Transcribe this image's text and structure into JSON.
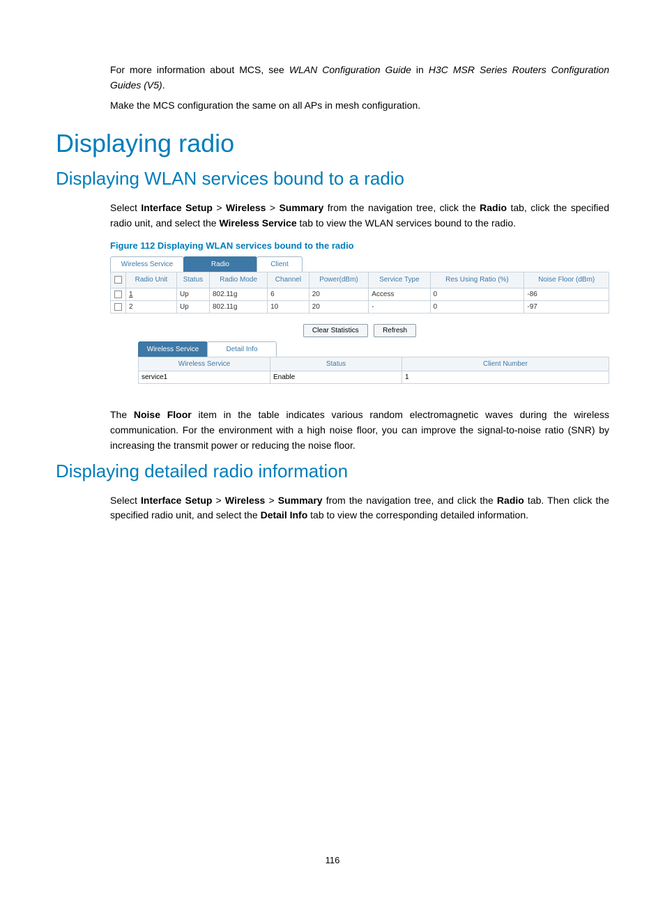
{
  "intro": {
    "p1_a": "For more information about MCS, see ",
    "p1_b": "WLAN Configuration Guide",
    "p1_c": " in ",
    "p1_d": "H3C MSR Series Routers Configuration Guides (V5)",
    "p1_e": ".",
    "p2": "Make the MCS configuration the same on all APs in mesh configuration."
  },
  "h1": "Displaying radio",
  "sec1": {
    "h2": "Displaying WLAN services bound to a radio",
    "p_a": "Select ",
    "p_b": "Interface Setup",
    "p_c": " > ",
    "p_d": "Wireless",
    "p_e": " > ",
    "p_f": "Summary",
    "p_g": " from the navigation tree, click the ",
    "p_h": "Radio",
    "p_i": " tab, click the specified radio unit, and select the ",
    "p_j": "Wireless Service",
    "p_k": " tab to view the WLAN services bound to the radio.",
    "figcap": "Figure 112 Displaying WLAN services bound to the radio"
  },
  "fig": {
    "tabs1": {
      "wireless_service": "Wireless Service",
      "radio": "Radio",
      "client": "Client"
    },
    "t1_headers": {
      "radio_unit": "Radio Unit",
      "status": "Status",
      "radio_mode": "Radio Mode",
      "channel": "Channel",
      "power": "Power(dBm)",
      "service_type": "Service Type",
      "res_using": "Res Using Ratio (%)",
      "noise_floor": "Noise Floor (dBm)"
    },
    "t1_rows": [
      {
        "unit": "1",
        "status": "Up",
        "mode": "802.11g",
        "channel": "6",
        "power": "20",
        "stype": "Access",
        "res": "0",
        "nf": "-86"
      },
      {
        "unit": "2",
        "status": "Up",
        "mode": "802.11g",
        "channel": "10",
        "power": "20",
        "stype": "-",
        "res": "0",
        "nf": "-97"
      }
    ],
    "buttons": {
      "clear": "Clear Statistics",
      "refresh": "Refresh"
    },
    "tabs2": {
      "wireless_service": "Wireless Service",
      "detail_info": "Detail Info"
    },
    "t2_headers": {
      "ws": "Wireless Service",
      "status": "Status",
      "cn": "Client Number"
    },
    "t2_row": {
      "ws": "service1",
      "status": "Enable",
      "cn": "1"
    }
  },
  "posttext": {
    "a": "The ",
    "b": "Noise Floor",
    "c": " item in the table indicates various random electromagnetic waves during the wireless communication. For the environment with a high noise floor, you can improve the signal-to-noise ratio (SNR) by increasing the transmit power or reducing the noise floor."
  },
  "sec2": {
    "h2": "Displaying detailed radio information",
    "p_a": "Select ",
    "p_b": "Interface Setup",
    "p_c": " > ",
    "p_d": "Wireless",
    "p_e": " > ",
    "p_f": "Summary",
    "p_g": " from the navigation tree, and click the ",
    "p_h": "Radio",
    "p_i": " tab. Then click the specified radio unit, and select the ",
    "p_j": "Detail Info",
    "p_k": " tab to view the corresponding detailed information."
  },
  "page_number": "116"
}
